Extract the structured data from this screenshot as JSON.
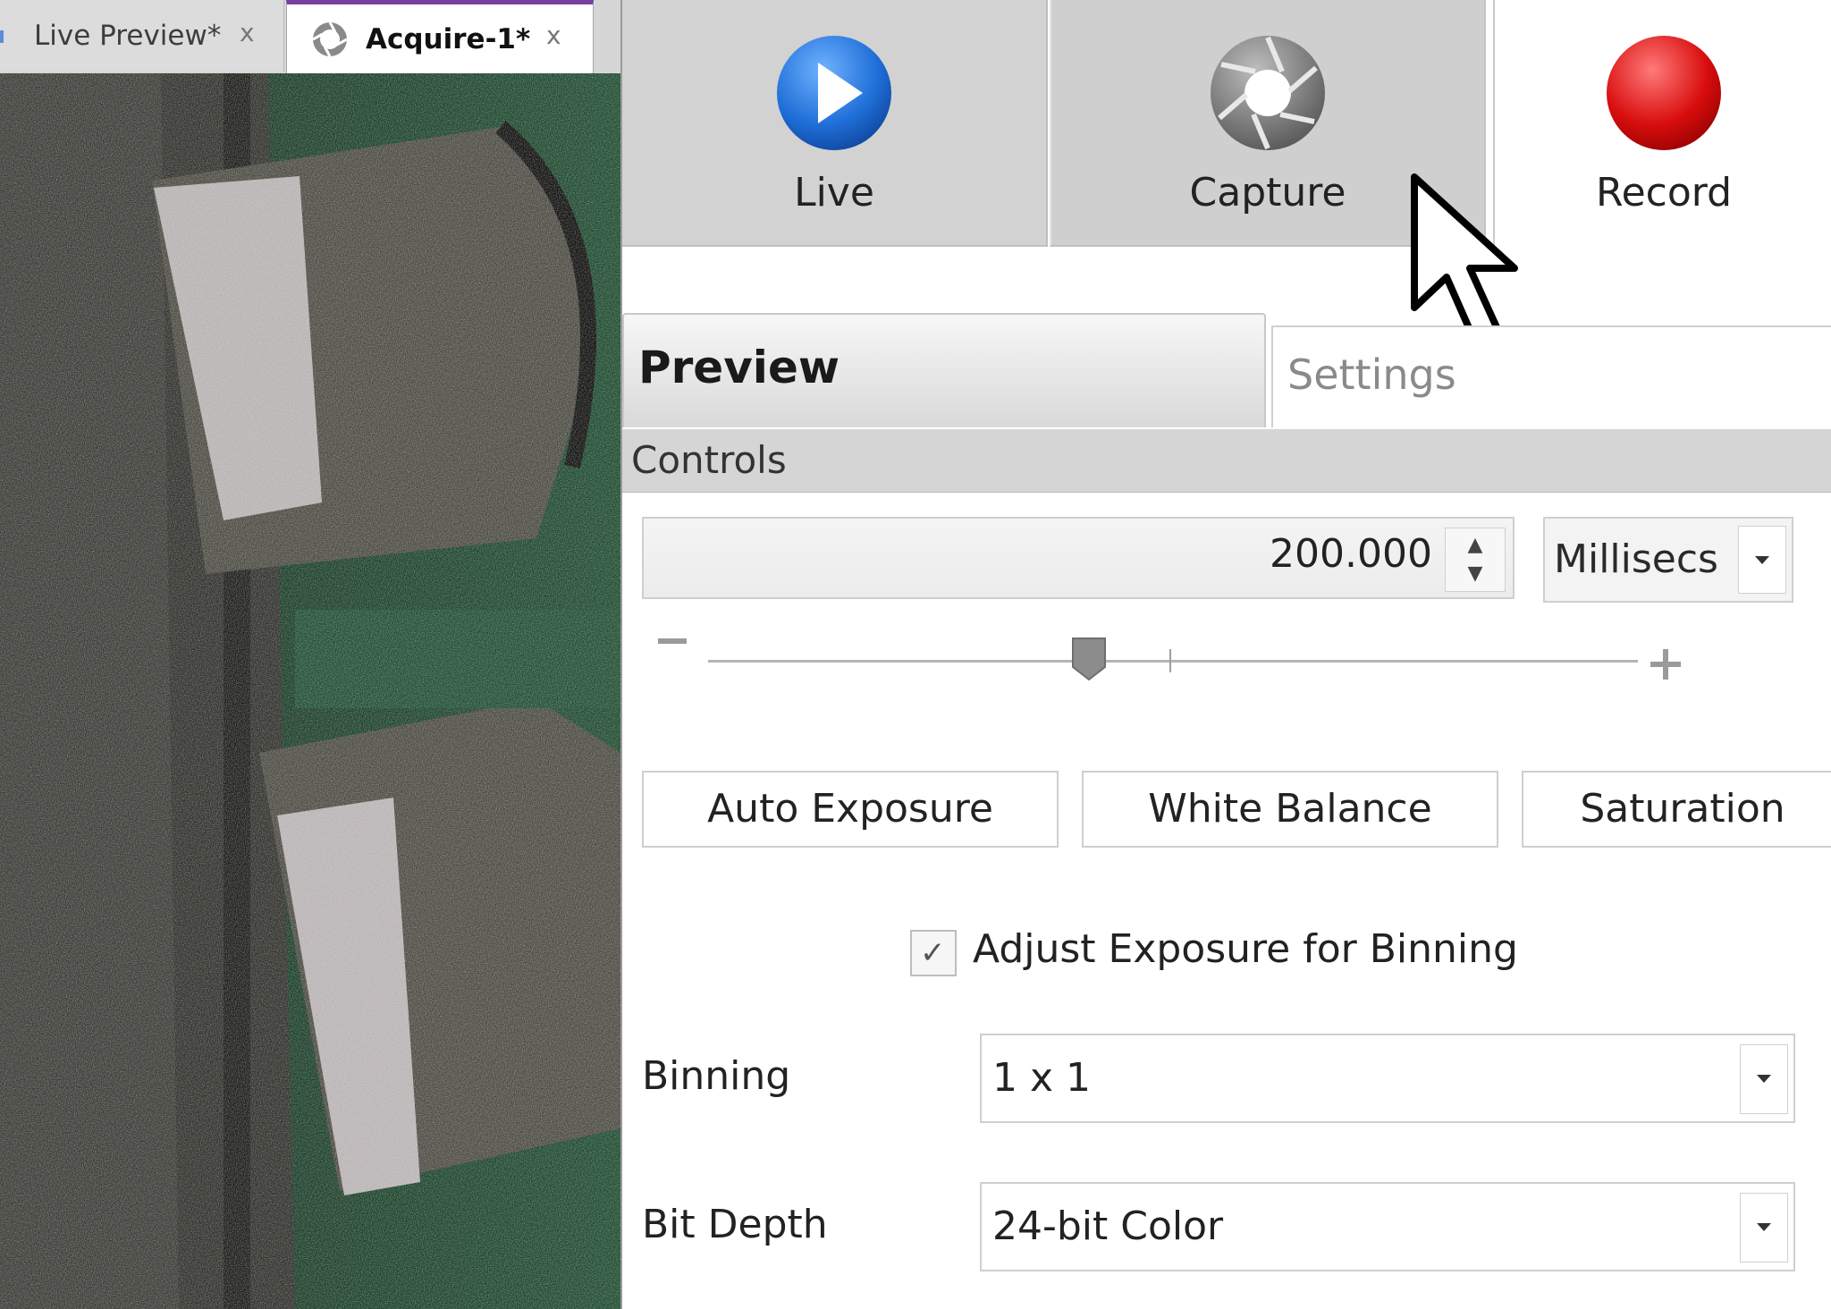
{
  "doc_tabs": [
    {
      "label": "Live Preview*",
      "close": "x",
      "active": false
    },
    {
      "label": "Acquire-1*",
      "close": "x",
      "active": true,
      "icon": "aperture-icon"
    }
  ],
  "ribbon": {
    "live": {
      "label": "Live",
      "icon": "play-icon",
      "color": "#1f6fd8"
    },
    "capture": {
      "label": "Capture",
      "icon": "aperture-icon",
      "color": "#707070"
    },
    "record": {
      "label": "Record",
      "icon": "record-icon",
      "color": "#d80d0d"
    }
  },
  "sub_tabs": {
    "preview": "Preview",
    "settings": "Settings"
  },
  "controls": {
    "header": "Controls",
    "exposure_value": "200.000",
    "exposure_unit": "Millisecs",
    "exposure_slider_fraction": 0.41,
    "buttons": {
      "auto_exposure": "Auto Exposure",
      "white_balance": "White Balance",
      "saturation": "Saturation"
    },
    "adjust_for_binning": {
      "label": "Adjust Exposure for Binning",
      "checked": true
    },
    "binning": {
      "label": "Binning",
      "value": "1 x 1"
    },
    "bit_depth": {
      "label": "Bit Depth",
      "value": "24-bit Color"
    }
  }
}
